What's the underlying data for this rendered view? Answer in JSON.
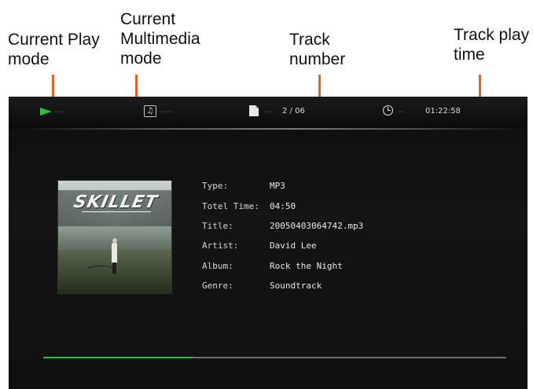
{
  "callouts": {
    "play_mode": "Current Play mode",
    "multimedia_mode": "Current Multimedia mode",
    "track_number": "Track number",
    "track_play_time": "Track play time"
  },
  "player": {
    "track_counter": "2 / 06",
    "play_time": "01:22:58",
    "progress_fraction": 0.325,
    "play_color": "#29c23b",
    "icons": {
      "play_mode": "play-icon",
      "multimedia_mode": "music-note-icon",
      "track_number": "document-icon",
      "play_time": "clock-icon"
    }
  },
  "album_art": {
    "band_name": "SKILLET"
  },
  "track_info": [
    {
      "label": "Type:",
      "value": "MP3"
    },
    {
      "label": "Totel Time:",
      "value": "04:50"
    },
    {
      "label": "Title:",
      "value": "20050403064742.mp3"
    },
    {
      "label": "Artist:",
      "value": "David Lee"
    },
    {
      "label": "Album:",
      "value": "Rock the Night"
    },
    {
      "label": "Genre:",
      "value": "Soundtrack"
    }
  ]
}
